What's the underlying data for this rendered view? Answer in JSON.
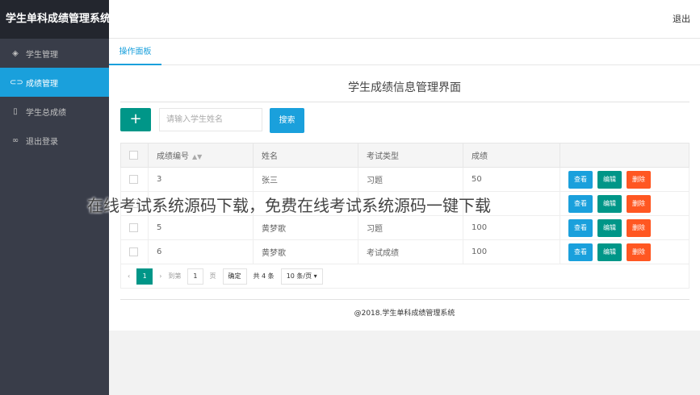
{
  "app": {
    "title": "学生单科成绩管理系统",
    "logout": "退出"
  },
  "sidebar": {
    "items": [
      {
        "label": "学生管理",
        "icon": "layers-icon"
      },
      {
        "label": "成绩管理",
        "icon": "link-icon",
        "active": true
      },
      {
        "label": "学生总成绩",
        "icon": "document-icon"
      },
      {
        "label": "退出登录",
        "icon": "loop-icon"
      }
    ]
  },
  "tabs": [
    {
      "label": "操作面板"
    }
  ],
  "page_title": "学生成绩信息管理界面",
  "toolbar": {
    "add_label": "+",
    "search_placeholder": "请输入学生姓名",
    "search_label": "搜索"
  },
  "table": {
    "headers": [
      "成绩编号",
      "姓名",
      "考试类型",
      "成绩"
    ],
    "rows": [
      {
        "id": "3",
        "name": "张三",
        "type": "习题",
        "score": "50"
      },
      {
        "id": "4",
        "name": "",
        "type": "",
        "score": ""
      },
      {
        "id": "5",
        "name": "黄梦歌",
        "type": "习题",
        "score": "100"
      },
      {
        "id": "6",
        "name": "黄梦歌",
        "type": "考试成绩",
        "score": "100"
      }
    ],
    "actions": {
      "view": "查看",
      "edit": "编辑",
      "delete": "删除"
    }
  },
  "pager": {
    "prev": "‹",
    "current": "1",
    "next": "›",
    "goto_label": "到第",
    "goto_value": "1",
    "page_unit": "页",
    "confirm": "确定",
    "total": "共 4 条",
    "page_size": "10 条/页"
  },
  "footer": "@2018.学生单科成绩管理系统",
  "watermark": "在线考试系统源码下载，免费在线考试系统源码一键下载",
  "colors": {
    "accent": "#1aa0dc",
    "green": "#009688",
    "danger": "#ff5722",
    "sidebar": "#393d49"
  }
}
